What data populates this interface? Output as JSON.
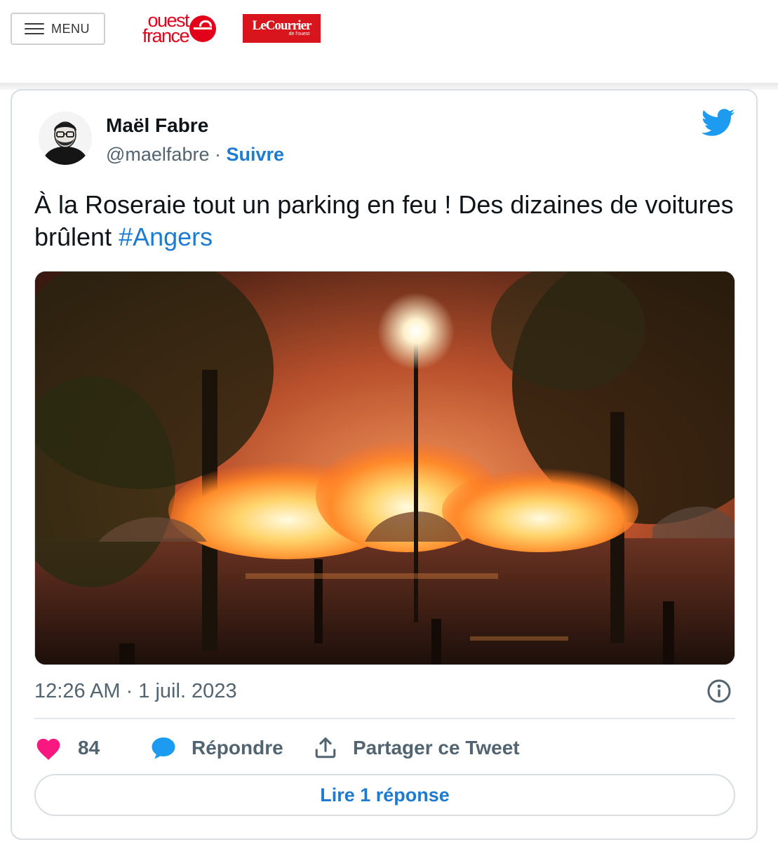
{
  "header": {
    "menu_label": "MENU",
    "logo_ouest_line1": "ouest",
    "logo_ouest_line2": "france",
    "logo_courrier_name": "LeCourrier",
    "logo_courrier_sub": "de l'ouest",
    "brand_color": "#e2001a"
  },
  "tweet": {
    "author_name": "Maël Fabre",
    "handle": "@maelfabre",
    "separator": " · ",
    "follow_label": "Suivre",
    "text": "À la Roseraie tout un parking en feu ! Des dizaines de voitures brûlent ",
    "hashtag": "#Angers",
    "timestamp": "12:26 AM · 1 juil. 2023",
    "likes_count": "84",
    "reply_label": "Répondre",
    "share_label": "Partager ce Tweet",
    "read_replies_label": "Lire 1 réponse",
    "accent_color": "#1d7bd1",
    "like_color": "#f91880",
    "icons": [
      "twitter-bird-icon",
      "info-icon",
      "heart-icon",
      "reply-bubble-icon",
      "share-icon"
    ]
  }
}
